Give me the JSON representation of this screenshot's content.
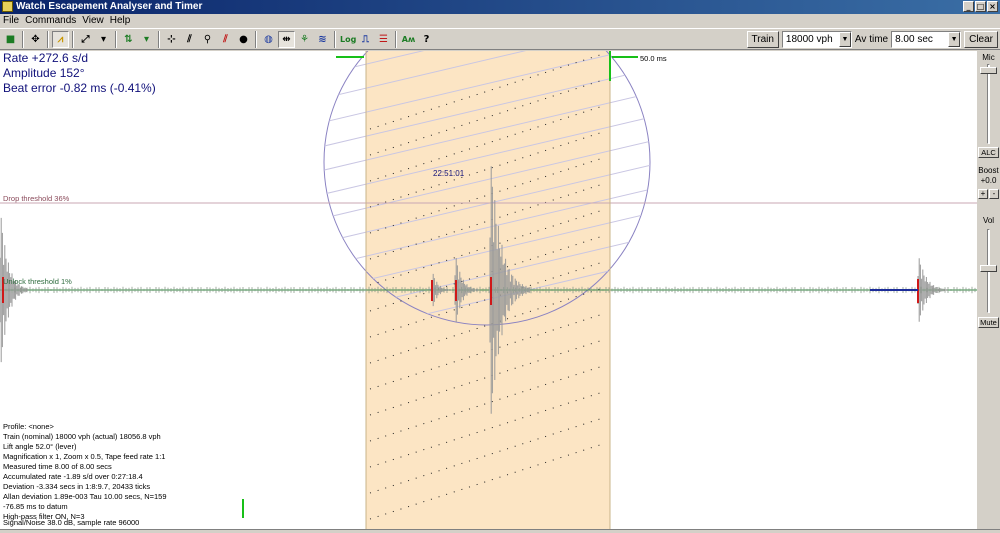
{
  "window": {
    "title": "Watch Escapement Analyser and Timer",
    "controls": [
      "_",
      "□",
      "×"
    ]
  },
  "menu": [
    "File",
    "Commands",
    "View",
    "Help"
  ],
  "toolbar": {
    "train_label": "Train",
    "train_value": "18000 vph",
    "av_time_label": "Av time",
    "av_time_value": "8.00 sec",
    "clear_label": "Clear"
  },
  "readouts": {
    "rate": "Rate +272.6 s/d",
    "amplitude": "Amplitude 152°",
    "beat_error": "Beat error -0.82 ms (-0.41%)"
  },
  "plot": {
    "drop_threshold": "Drop threshold 36%",
    "unlock_threshold": "Unlock threshold 1%",
    "timestamp": "22:51:01",
    "window_width": "50.0 ms",
    "colors": {
      "window": "#fce5c4",
      "circle": "#8a82c2",
      "wave": "#9a9a9a",
      "grid": "#c9c6e3",
      "threshold": "#c9a7b3",
      "baseline": "#2c8a3c",
      "marker": "#d01818"
    }
  },
  "info_lines": [
    "Profile: <none>",
    "Train (nominal) 18000 vph (actual) 18056.8 vph",
    "Lift angle  52.0° (lever)",
    "Magnification x 1, Zoom x 0.5, Tape feed rate 1:1",
    "Measured time 8.00 of 8.00 secs",
    "Accumulated rate -1.89 s/d over 0:27:18.4",
    "Deviation -3.334 secs in 1:8:9.7, 20433 ticks",
    "Allan deviation 1.89e-003 Tau 10.00 secs, N=159",
    " -76.85 ms to datum",
    "High-pass filter ON, N=3",
    "Signal/Noise 38.0 dB, sample rate 96000"
  ],
  "side": {
    "mic": "Mic",
    "alc": "ALC",
    "boost": "Boost",
    "boost_value": "+0.0",
    "plus": "+",
    "minus": "-",
    "vol": "Vol",
    "mute": "Mute"
  }
}
